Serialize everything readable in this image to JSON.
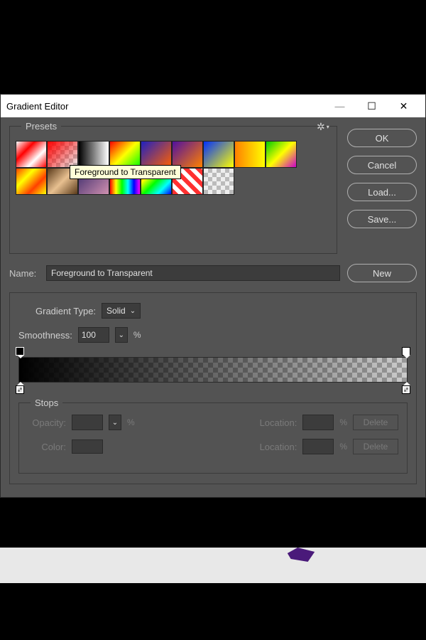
{
  "titlebar": {
    "title": "Gradient Editor",
    "min": "—",
    "max": "☐",
    "close": "✕"
  },
  "presets": {
    "label": "Presets",
    "tooltip": "Foreground to Transparent"
  },
  "buttons": {
    "ok": "OK",
    "cancel": "Cancel",
    "load": "Load...",
    "save": "Save...",
    "new": "New"
  },
  "name": {
    "label": "Name:",
    "value": "Foreground to Transparent"
  },
  "gradientType": {
    "label": "Gradient Type:",
    "value": "Solid"
  },
  "smoothness": {
    "label": "Smoothness:",
    "value": "100",
    "unit": "%"
  },
  "stops": {
    "label": "Stops",
    "opacity_label": "Opacity:",
    "color_label": "Color:",
    "location_label": "Location:",
    "percent": "%",
    "delete": "Delete"
  }
}
